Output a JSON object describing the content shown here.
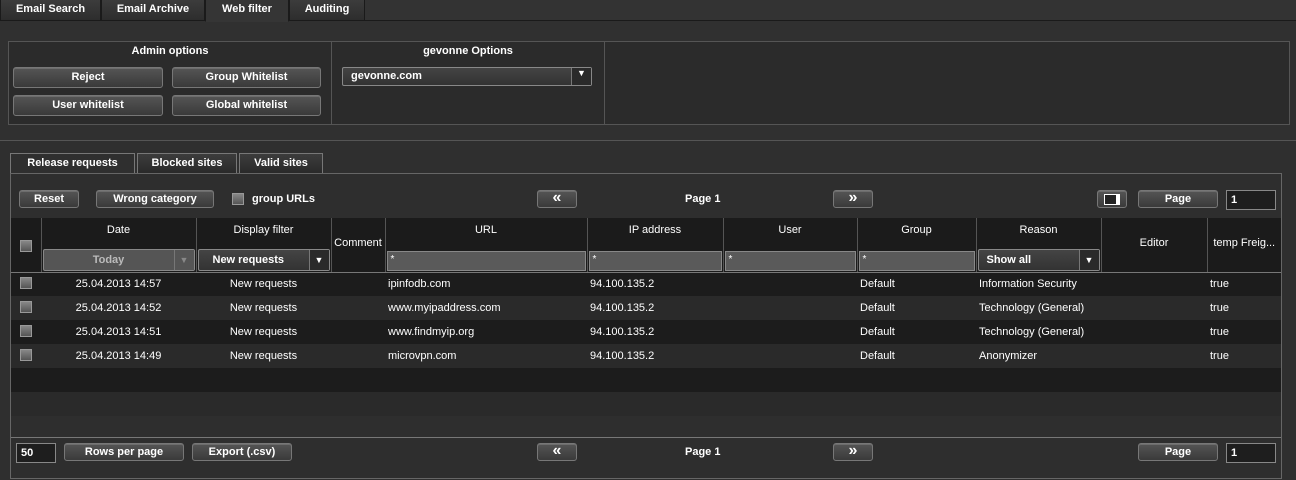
{
  "top_tabs": [
    "Email Search",
    "Email Archive",
    "Web filter",
    "Auditing"
  ],
  "admin_options": {
    "title": "Admin options",
    "buttons": [
      "Reject",
      "Group Whitelist",
      "User whitelist",
      "Global whitelist"
    ]
  },
  "domain_options": {
    "title": "gevonne Options",
    "selected_domain": "gevonne.com"
  },
  "sub_tabs": [
    "Release requests",
    "Blocked sites",
    "Valid sites"
  ],
  "toolbar": {
    "reset": "Reset",
    "wrong_category": "Wrong category",
    "group_urls": "group URLs",
    "page_label": "Page 1",
    "page_button": "Page",
    "page_value": "1"
  },
  "columns": {
    "date": "Date",
    "date_filter": "Today",
    "display_filter": "Display filter",
    "display_filter_value": "New requests",
    "comment": "Comment",
    "url": "URL",
    "url_filter": "*",
    "ip": "IP address",
    "ip_filter": "*",
    "user": "User",
    "user_filter": "*",
    "group": "Group",
    "group_filter": "*",
    "reason": "Reason",
    "reason_filter": "Show all",
    "editor": "Editor",
    "temp": "temp Freig..."
  },
  "rows": [
    {
      "date": "25.04.2013 14:57",
      "status": "New requests",
      "url": "ipinfodb.com",
      "ip": "94.100.135.2",
      "group": "Default",
      "reason": "Information Security",
      "temp": "true"
    },
    {
      "date": "25.04.2013 14:52",
      "status": "New requests",
      "url": "www.myipaddress.com",
      "ip": "94.100.135.2",
      "group": "Default",
      "reason": "Technology (General)",
      "temp": "true"
    },
    {
      "date": "25.04.2013 14:51",
      "status": "New requests",
      "url": "www.findmyip.org",
      "ip": "94.100.135.2",
      "group": "Default",
      "reason": "Technology (General)",
      "temp": "true"
    },
    {
      "date": "25.04.2013 14:49",
      "status": "New requests",
      "url": "microvpn.com",
      "ip": "94.100.135.2",
      "group": "Default",
      "reason": "Anonymizer",
      "temp": "true"
    }
  ],
  "footer": {
    "rows_per_page_value": "50",
    "rows_per_page": "Rows per page",
    "export": "Export (.csv)",
    "page_label": "Page 1",
    "page_button": "Page",
    "page_value": "1"
  }
}
